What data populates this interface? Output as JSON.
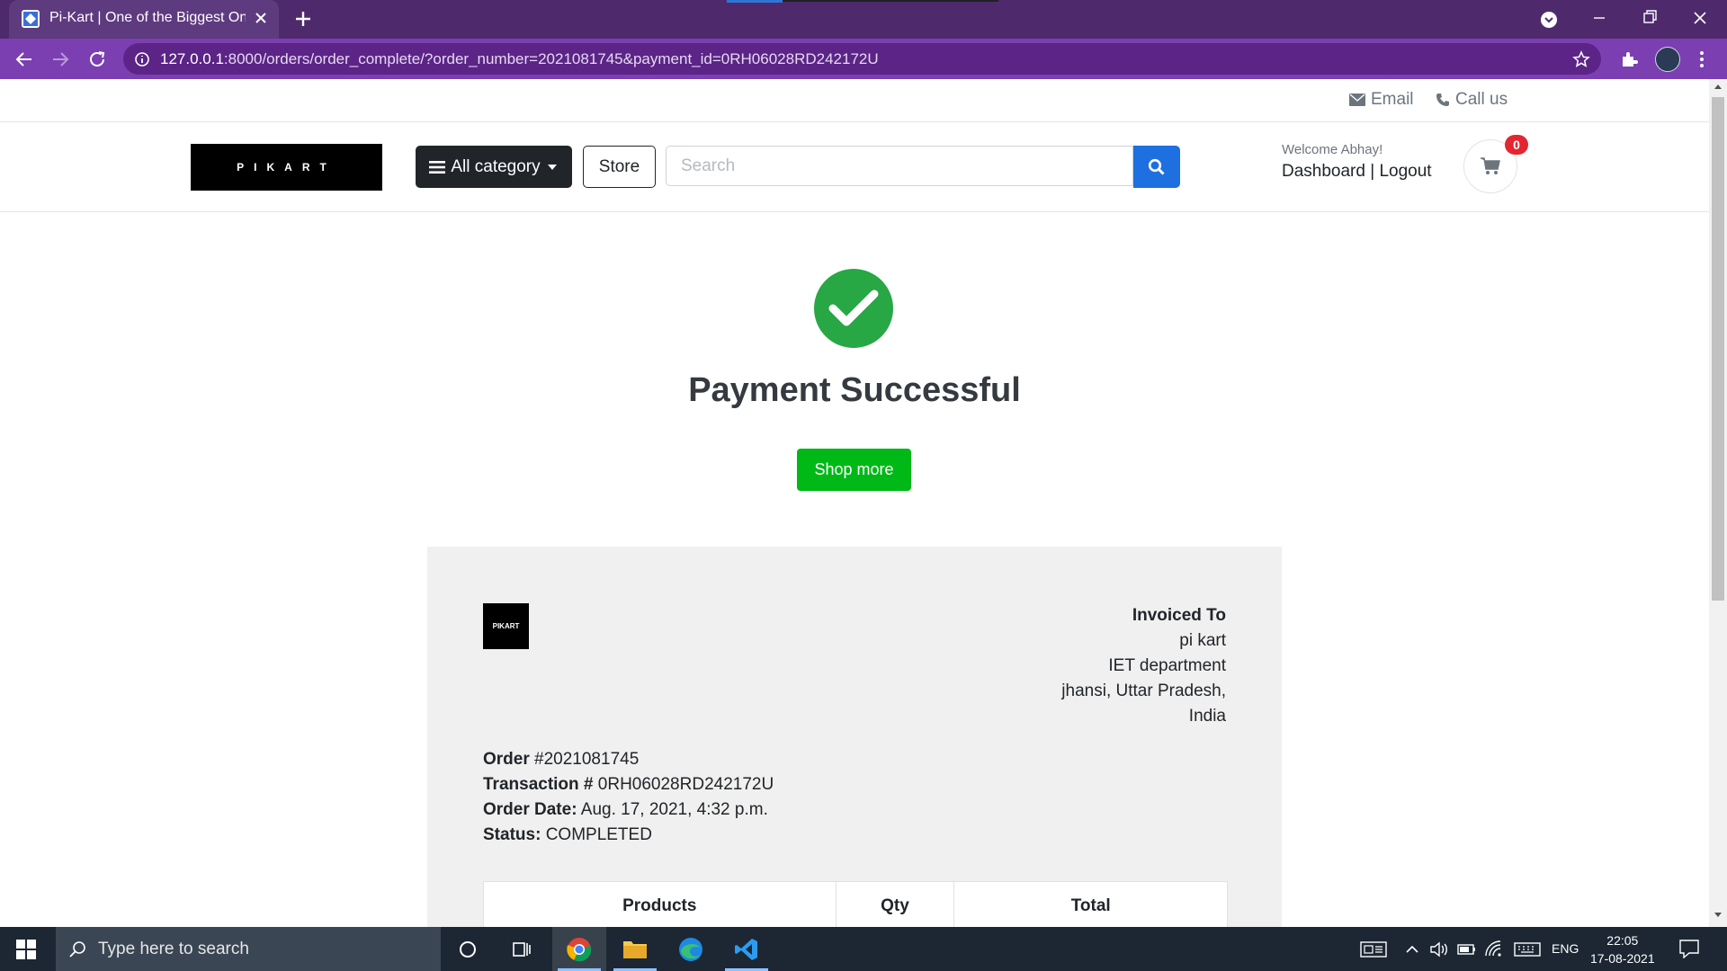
{
  "browser": {
    "tab_title": "Pi-Kart | One of the Biggest Online Shopping Platform",
    "url_host": "127.0.0.1",
    "url_path": ":8000/orders/order_complete/?order_number=2021081745&payment_id=0RH06028RD242172U"
  },
  "topbar": {
    "email_label": "Email",
    "call_label": "Call us"
  },
  "header": {
    "logo_text": "PIKART",
    "category_label": "All category",
    "store_label": "Store",
    "search_placeholder": "Search",
    "welcome_text": "Welcome Abhay!",
    "dashboard_label": "Dashboard",
    "separator": "|",
    "logout_label": "Logout",
    "cart_count": "0"
  },
  "main": {
    "title": "Payment Successful",
    "shop_more_label": "Shop more"
  },
  "invoice": {
    "logo_text": "PIKART",
    "invoiced_to_heading": "Invoiced To",
    "address_lines": [
      "pi kart",
      "IET department",
      "jhansi, Uttar Pradesh,",
      "India"
    ],
    "order_label": "Order",
    "order_value": "#2021081745",
    "transaction_label": "Transaction #",
    "transaction_value": "0RH06028RD242172U",
    "order_date_label": "Order Date:",
    "order_date_value": "Aug. 17, 2021, 4:32 p.m.",
    "status_label": "Status:",
    "status_value": "COMPLETED",
    "columns": [
      "Products",
      "Qty",
      "Total"
    ]
  },
  "taskbar": {
    "search_placeholder": "Type here to search",
    "language": "ENG",
    "time": "22:05",
    "date": "17-08-2021"
  },
  "colors": {
    "browser_frame": "#4e2a6c",
    "address_bar": "#7b3fb2",
    "search_button": "#1e6fe0",
    "success_green": "#28a745",
    "shop_more_green": "#00b916",
    "cart_badge": "#e3262f"
  }
}
